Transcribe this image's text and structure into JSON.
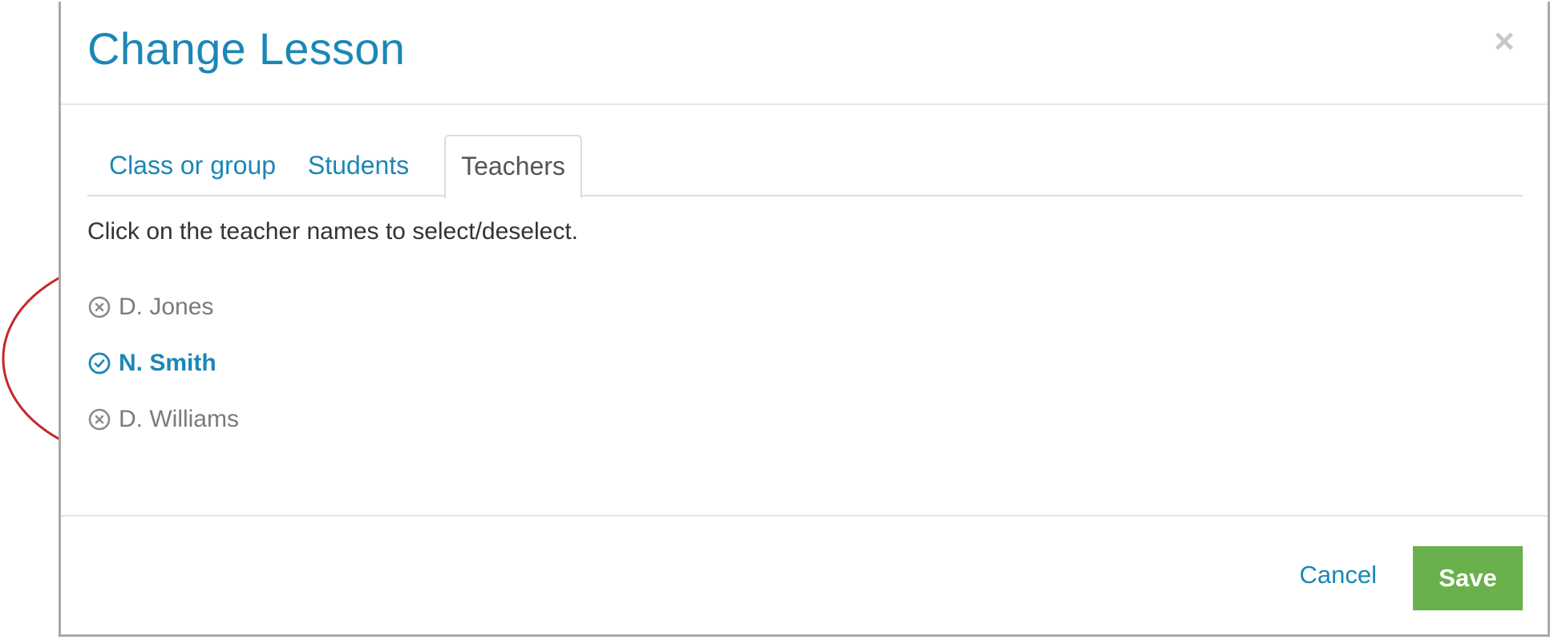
{
  "modal": {
    "title": "Change Lesson",
    "close_glyph": "×",
    "close_icon": "close-icon"
  },
  "tabs": [
    {
      "label": "Class or group",
      "active": false
    },
    {
      "label": "Students",
      "active": false
    },
    {
      "label": "Teachers",
      "active": true
    }
  ],
  "instructions": "Click on the teacher names to select/deselect.",
  "teachers": [
    {
      "name": "D. Jones",
      "selected": false,
      "icon": "unselected-x-circle-icon"
    },
    {
      "name": "N. Smith",
      "selected": true,
      "icon": "selected-check-circle-icon"
    },
    {
      "name": "D. Williams",
      "selected": false,
      "icon": "unselected-x-circle-icon"
    }
  ],
  "footer": {
    "cancel_label": "Cancel",
    "save_label": "Save"
  },
  "colors": {
    "accent": "#1b87b6",
    "save_green": "#6ab04c",
    "muted_text": "#7a7a7a",
    "annotation_red": "#c62828"
  }
}
